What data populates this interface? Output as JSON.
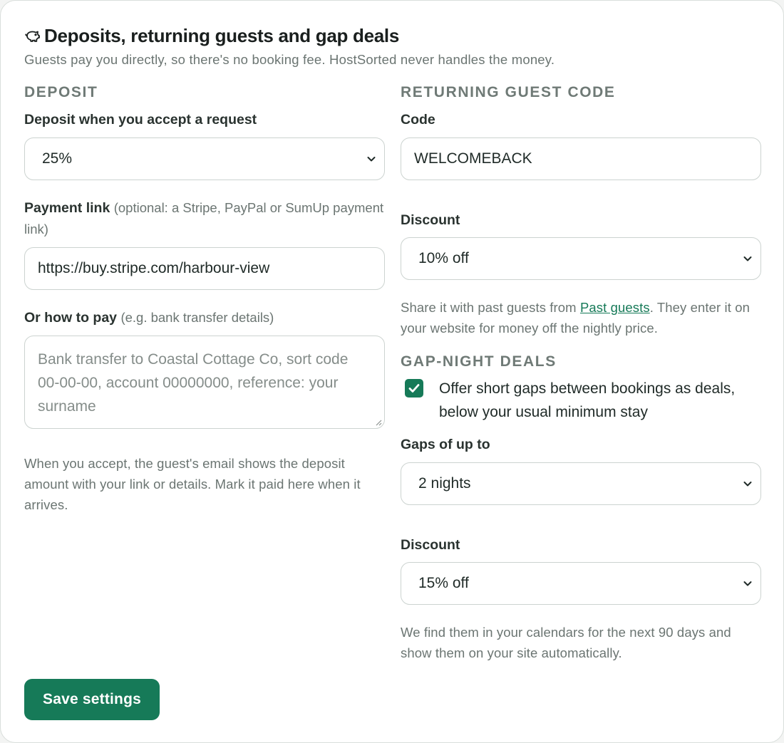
{
  "header": {
    "icon": "piggy-bank-icon",
    "title": "Deposits, returning guests and gap deals",
    "subtitle": "Guests pay you directly, so there's no booking fee. HostSorted never handles the money."
  },
  "deposit": {
    "section_title": "DEPOSIT",
    "amount_label": "Deposit when you accept a request",
    "amount_value": "25%",
    "payment_link_label": "Payment link",
    "payment_link_hint": "(optional: a Stripe, PayPal or SumUp payment link)",
    "payment_link_value": "https://buy.stripe.com/harbour-view",
    "how_to_pay_label": "Or how to pay",
    "how_to_pay_hint": "(e.g. bank transfer details)",
    "how_to_pay_placeholder": "Bank transfer to Coastal Cottage Co, sort code 00-00-00, account 00000000, reference: your surname",
    "note": "When you accept, the guest's email shows the deposit amount with your link or details. Mark it paid here when it arrives."
  },
  "returning": {
    "section_title": "RETURNING GUEST CODE",
    "code_label": "Code",
    "code_value": "WELCOMEBACK",
    "discount_label": "Discount",
    "discount_value": "10% off",
    "note_prefix": "Share it with past guests from ",
    "note_link": "Past guests",
    "note_suffix": ". They enter it on your website for money off the nightly price."
  },
  "gap": {
    "section_title": "GAP-NIGHT DEALS",
    "checkbox_label": "Offer short gaps between bookings as deals, below your usual minimum stay",
    "checkbox_checked": true,
    "gaps_label": "Gaps of up to",
    "gaps_value": "2 nights",
    "discount_label": "Discount",
    "discount_value": "15% off",
    "note": "We find them in your calendars for the next 90 days and show them on your site automatically."
  },
  "actions": {
    "save_label": "Save settings"
  },
  "colors": {
    "accent": "#167a58",
    "muted_text": "#6b7572",
    "section_title": "#6f7a76"
  }
}
